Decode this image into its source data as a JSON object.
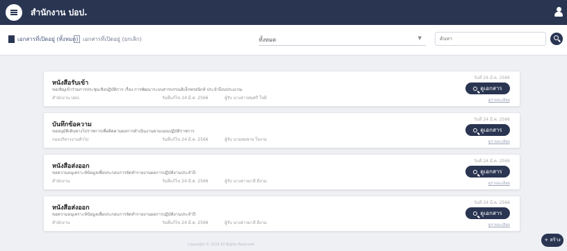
{
  "header": {
    "title": "สำนักงาน ปอป."
  },
  "toolbar": {
    "tabs": [
      {
        "label": "เอกสารที่เปิดอยู่ (ทั้งหมด)"
      },
      {
        "label": "เอกสารที่เปิดอยู่ (ยกเลิก)"
      }
    ],
    "filter": {
      "value": "ทั้งหมด"
    },
    "search": {
      "placeholder": "ค้นหา"
    }
  },
  "documents": [
    {
      "title": "หนังสือรับเข้า",
      "description": "ขอเชิญเข้าร่วมการประชุมเชิงปฏิบัติการ เรื่อง การพัฒนาระบบสารบรรณอิเล็กทรอนิกส์ ประจำปีงบประมาณ",
      "owner": "สำนักงาน ปอป.",
      "updated": "วันที่แก้ไข 24 มี.ค. 2566",
      "assignee": "ผู้รับ นางสาวสมศรี ใจดี",
      "date": "วันที่ 24 มี.ค. 2566",
      "button": "ดูเอกสาร",
      "more": "ดูรายละเอียด"
    },
    {
      "title": "บันทึกข้อความ",
      "description": "ขออนุมัติเดินทางไปราชการเพื่อติดตามผลการดำเนินงานตามแผนปฏิบัติราชการ",
      "owner": "กองบริหารงานทั่วไป",
      "updated": "วันที่แก้ไข 24 มี.ค. 2566",
      "assignee": "ผู้รับ นายสมชาย ใจงาม",
      "date": "วันที่ 24 มี.ค. 2566",
      "button": "ดูเอกสาร",
      "more": "ดูรายละเอียด"
    },
    {
      "title": "หนังสือส่งออก",
      "description": "ขอความอนุเคราะห์ข้อมูลเพื่อประกอบการจัดทำรายงานผลการปฏิบัติงานประจำปี",
      "owner": "สำนักงาน",
      "updated": "วันที่แก้ไข 24 มี.ค. 2566",
      "assignee": "ผู้รับ นางสาวมาลี ดีงาม",
      "date": "วันที่ 24 มี.ค. 2566",
      "button": "ดูเอกสาร",
      "more": "ดูรายละเอียด"
    },
    {
      "title": "หนังสือส่งออก",
      "description": "ขอความอนุเคราะห์ข้อมูลเพื่อประกอบการจัดทำรายงานผลการปฏิบัติงานประจำปี",
      "owner": "สำนักงาน",
      "updated": "วันที่แก้ไข 24 มี.ค. 2566",
      "assignee": "ผู้รับ นางสาวมาลี ดีงาม",
      "date": "วันที่ 24 มี.ค. 2566",
      "button": "ดูเอกสาร",
      "more": "ดูรายละเอียด"
    }
  ],
  "footer": {
    "text": "Copyright © 2023 All Rights Reserved"
  },
  "fab": {
    "label": "+ สร้าง"
  },
  "colors": {
    "primary": "#2a3552",
    "background": "#eef0f4",
    "card": "#ffffff"
  }
}
